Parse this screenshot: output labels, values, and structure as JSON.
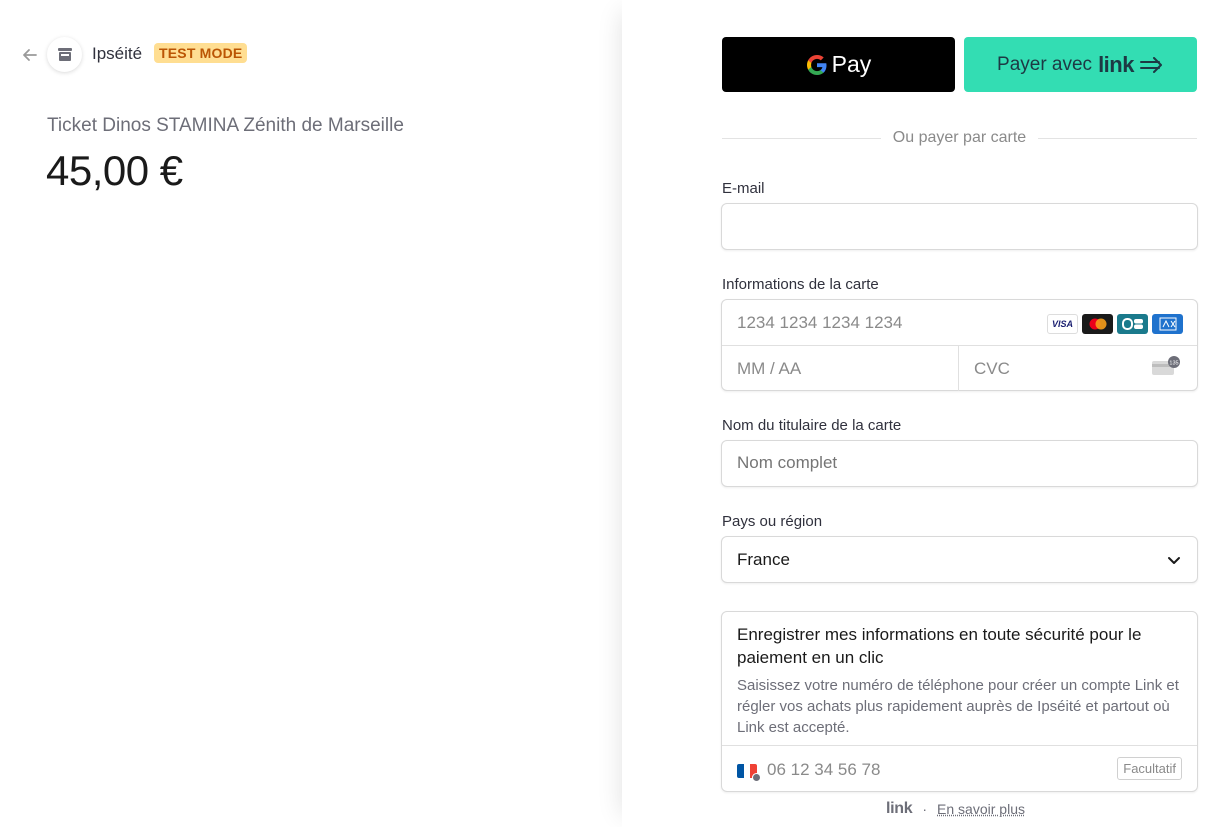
{
  "header": {
    "merchant_name": "Ipséité",
    "badge": "TEST MODE"
  },
  "summary": {
    "product_name": "Ticket Dinos STAMINA Zénith de Marseille",
    "price": "45,00 €"
  },
  "wallets": {
    "gpay_label": "Pay",
    "link_prefix": "Payer avec",
    "link_word": "link"
  },
  "divider_text": "Ou payer par carte",
  "form": {
    "email_label": "E-mail",
    "email_value": "",
    "card_label": "Informations de la carte",
    "card_number_placeholder": "1234 1234 1234 1234",
    "expiry_placeholder": "MM / AA",
    "cvc_placeholder": "CVC",
    "cvc_icon_text": "135",
    "card_brands": [
      "VISA",
      "MC",
      "CB",
      "AMEX"
    ],
    "holder_label": "Nom du titulaire de la carte",
    "holder_placeholder": "Nom complet",
    "country_label": "Pays ou région",
    "country_value": "France"
  },
  "save": {
    "title": "Enregistrer mes informations en toute sécurité pour le paiement en un clic",
    "description": "Saisissez votre numéro de téléphone pour créer un compte Link et régler vos achats plus rapidement auprès de Ipséité et partout où Link est accepté.",
    "phone_placeholder": "06 12 34 56 78",
    "optional_label": "Facultatif"
  },
  "footer": {
    "link_word": "link",
    "separator": "·",
    "learn_more": "En savoir plus"
  },
  "colors": {
    "link_green": "#33ddb3",
    "badge_bg": "#ffde92",
    "badge_text": "#bb5504"
  }
}
